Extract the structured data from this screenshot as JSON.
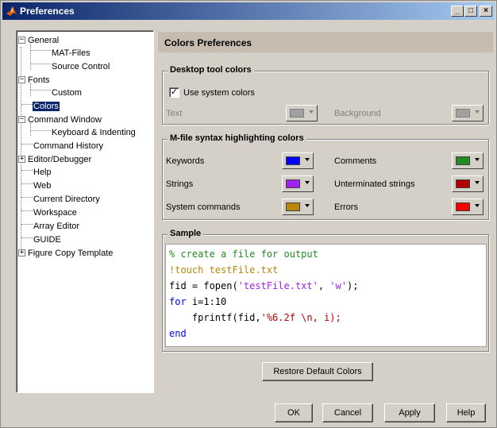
{
  "window": {
    "title": "Preferences",
    "controls": {
      "minimize": "_",
      "maximize": "□",
      "close": "×"
    }
  },
  "tree": {
    "items": [
      {
        "label": "General",
        "expander": "−"
      },
      {
        "label": "MAT-Files"
      },
      {
        "label": "Source Control"
      },
      {
        "label": "Fonts",
        "expander": "−"
      },
      {
        "label": "Custom"
      },
      {
        "label": "Colors",
        "selected": true
      },
      {
        "label": "Command Window",
        "expander": "−"
      },
      {
        "label": "Keyboard & Indenting"
      },
      {
        "label": "Command History"
      },
      {
        "label": "Editor/Debugger",
        "expander": "+"
      },
      {
        "label": "Help"
      },
      {
        "label": "Web"
      },
      {
        "label": "Current Directory"
      },
      {
        "label": "Workspace"
      },
      {
        "label": "Array Editor"
      },
      {
        "label": "GUIDE"
      },
      {
        "label": "Figure Copy Template",
        "expander": "+"
      }
    ]
  },
  "panel": {
    "header": "Colors Preferences",
    "desktop": {
      "title": "Desktop tool colors",
      "use_system_label": "Use system colors",
      "use_system_checked": "✓",
      "text_label": "Text",
      "background_label": "Background",
      "text_color": "#a0a0a0",
      "background_color": "#a0a0a0"
    },
    "syntax": {
      "title": "M-file syntax highlighting colors",
      "keywords_label": "Keywords",
      "keywords_color": "#0000ff",
      "comments_label": "Comments",
      "comments_color": "#228b22",
      "strings_label": "Strings",
      "strings_color": "#a020f0",
      "unterminated_label": "Unterminated strings",
      "unterminated_color": "#b20000",
      "system_label": "System commands",
      "system_color": "#b8860b",
      "errors_label": "Errors",
      "errors_color": "#ff0000"
    },
    "sample": {
      "title": "Sample",
      "line1": "% create a file for output",
      "line2": "!touch testFile.txt",
      "line3a": "fid = fopen(",
      "line3b": "'testFile.txt'",
      "line3c": ", ",
      "line3d": "'w'",
      "line3e": ");",
      "line4a": "for",
      "line4b": " i=1:10",
      "line5a": "    fprintf(fid,",
      "line5b": "'%6.2f \\n, i);",
      "line6": "end"
    },
    "restore_label": "Restore Default Colors"
  },
  "buttons": {
    "ok": "OK",
    "cancel": "Cancel",
    "apply": "Apply",
    "help": "Help"
  }
}
